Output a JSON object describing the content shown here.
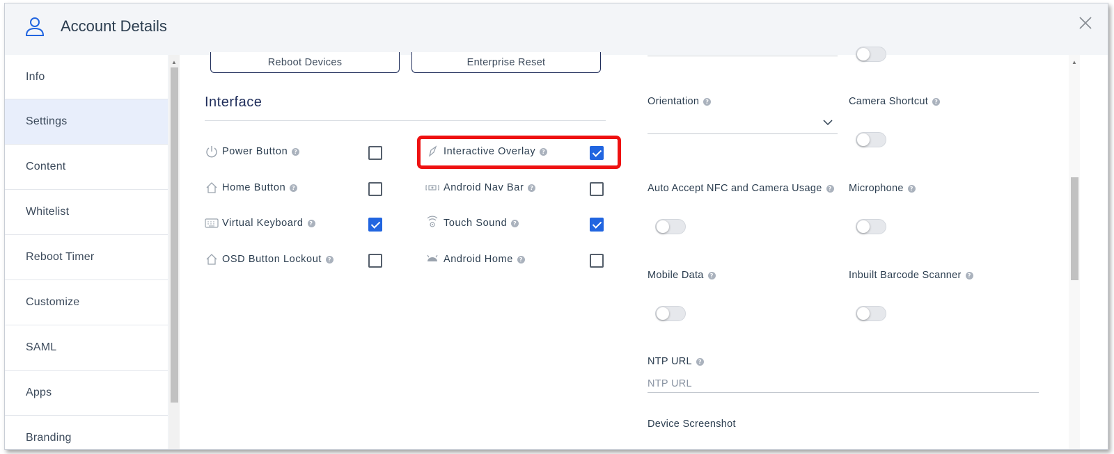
{
  "header": {
    "title": "Account Details"
  },
  "sidebar": {
    "items": [
      {
        "label": "Info"
      },
      {
        "label": "Settings"
      },
      {
        "label": "Content"
      },
      {
        "label": "Whitelist"
      },
      {
        "label": "Reboot Timer"
      },
      {
        "label": "Customize"
      },
      {
        "label": "SAML"
      },
      {
        "label": "Apps"
      },
      {
        "label": "Branding"
      }
    ],
    "active": "Settings"
  },
  "actions": {
    "reboot_label": "Reboot Devices",
    "reset_label": "Enterprise Reset"
  },
  "interface": {
    "title": "Interface",
    "options": [
      {
        "label": "Power Button",
        "checked": false,
        "icon": "power-icon"
      },
      {
        "label": "Interactive Overlay",
        "checked": true,
        "icon": "overlay-icon",
        "highlighted": true
      },
      {
        "label": "Home Button",
        "checked": false,
        "icon": "home-icon"
      },
      {
        "label": "Android Nav Bar",
        "checked": false,
        "icon": "nav-bar-icon"
      },
      {
        "label": "Virtual Keyboard",
        "checked": true,
        "icon": "keyboard-icon"
      },
      {
        "label": "Touch Sound",
        "checked": true,
        "icon": "touch-sound-icon"
      },
      {
        "label": "OSD Button Lockout",
        "checked": false,
        "icon": "home-icon"
      },
      {
        "label": "Android Home",
        "checked": false,
        "icon": "android-icon"
      }
    ]
  },
  "settings": {
    "orientation_label": "Orientation",
    "camera_shortcut_label": "Camera Shortcut",
    "auto_accept_label": "Auto Accept NFC and Camera Usage",
    "microphone_label": "Microphone",
    "mobile_data_label": "Mobile Data",
    "barcode_label": "Inbuilt Barcode Scanner",
    "ntp_url_label": "NTP URL",
    "ntp_url_placeholder": "NTP URL",
    "device_screenshot_label": "Device Screenshot"
  },
  "colors": {
    "accent": "#2165e0",
    "highlight": "#ee1111",
    "navy": "#1f2d5a"
  }
}
